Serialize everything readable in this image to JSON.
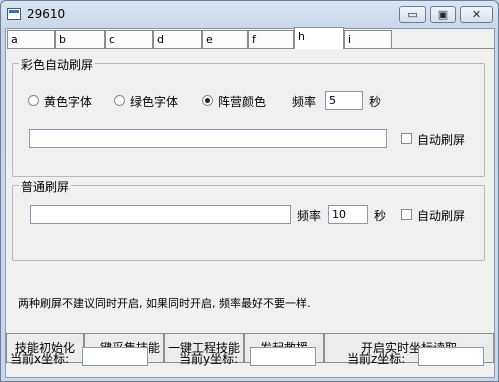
{
  "window": {
    "title": "29610"
  },
  "tabs": [
    {
      "label": "a",
      "active": false
    },
    {
      "label": "b",
      "active": false
    },
    {
      "label": "c",
      "active": false
    },
    {
      "label": "d",
      "active": false
    },
    {
      "label": "e",
      "active": false
    },
    {
      "label": "f",
      "active": false
    },
    {
      "label": "h",
      "active": true
    },
    {
      "label": "i",
      "active": false
    }
  ],
  "color_refresh": {
    "group_title": "彩色自动刷屏",
    "radio_yellow": "黄色字体",
    "radio_green": "绿色字体",
    "radio_faction": "阵营颜色",
    "selected": "阵营颜色",
    "freq_label": "频率",
    "freq_value": "5",
    "sec_label": "秒",
    "text_value": "",
    "auto_label": "自动刷屏"
  },
  "normal_refresh": {
    "group_title": "普通刷屏",
    "text_value": "",
    "freq_label": "频率",
    "freq_value": "10",
    "sec_label": "秒",
    "auto_label": "自动刷屏"
  },
  "note": "两种刷屏不建议同时开启, 如果同时开启, 频率最好不要一样.",
  "buttons": {
    "init": "技能初始化",
    "collect": "一键采集技能",
    "engineering": "一键工程技能",
    "rescue": "发起救援",
    "realtime": "开启实时坐标读取"
  },
  "coords": {
    "x_label": "当前x坐标:",
    "y_label": "当前y坐标:",
    "z_label": "当前z坐标:",
    "x_value": "",
    "y_value": "",
    "z_value": ""
  }
}
